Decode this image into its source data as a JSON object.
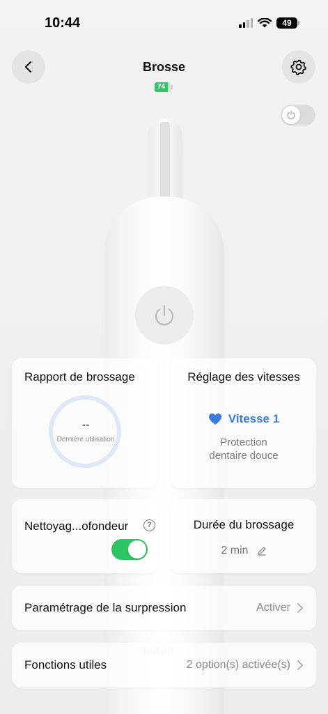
{
  "status_bar": {
    "time": "10:44",
    "battery": "49"
  },
  "header": {
    "title": "Brosse",
    "device_battery": "74"
  },
  "brand": {
    "logo_text": "laifen"
  },
  "cards": {
    "report": {
      "title": "Rapport de brossage",
      "value": "--",
      "caption": "Dernière utilisation"
    },
    "speed": {
      "title": "Réglage des vitesses",
      "value": "Vitesse 1",
      "description_line1": "Protection",
      "description_line2": "dentaire douce"
    },
    "clean": {
      "title": "Nettoyag...ofondeur",
      "help": "?",
      "toggle_on": true
    },
    "duration": {
      "title": "Durée du brossage",
      "value": "2 min"
    }
  },
  "rows": {
    "suppression": {
      "label": "Paramétrage de la surpression",
      "value": "Activer"
    },
    "functions": {
      "label": "Fonctions utiles",
      "value": "2 option(s) activée(s)"
    }
  },
  "colors": {
    "accent_blue": "#3b7be0",
    "toggle_green": "#2ec564",
    "battery_green": "#39c36b"
  }
}
